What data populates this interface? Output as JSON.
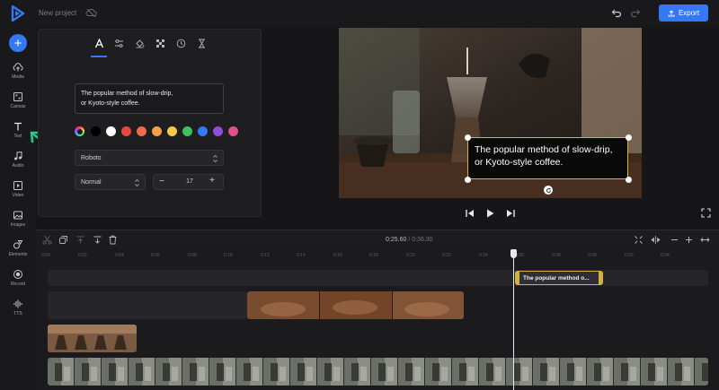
{
  "app": {
    "project_name": "New project",
    "export_label": "Export"
  },
  "sidebar": {
    "items": [
      {
        "label": "Media",
        "icon": "cloud-upload-icon"
      },
      {
        "label": "Canvas",
        "icon": "canvas-icon"
      },
      {
        "label": "Text",
        "icon": "text-icon"
      },
      {
        "label": "Audio",
        "icon": "music-note-icon"
      },
      {
        "label": "Video",
        "icon": "video-play-icon"
      },
      {
        "label": "Images",
        "icon": "image-icon"
      },
      {
        "label": "Elements",
        "icon": "shapes-icon"
      },
      {
        "label": "Record",
        "icon": "record-icon"
      },
      {
        "label": "TTS",
        "icon": "waveform-icon"
      }
    ]
  },
  "text_panel": {
    "tabs": [
      "text-style-icon",
      "sliders-icon",
      "fill-bucket-icon",
      "checkerboard-icon",
      "clock-icon",
      "hourglass-icon"
    ],
    "active_tab": "text-style-icon",
    "text_value": "The popular method of slow-drip,\nor Kyoto-style coffee.",
    "colors": [
      "#000000",
      "#ffffff",
      "#e8473f",
      "#f06a4f",
      "#f3a046",
      "#f5c84b",
      "#3fbf62",
      "#3478f6",
      "#8e4fd6",
      "#e0508c"
    ],
    "font": "Roboto",
    "weight": "Normal",
    "font_size": "17"
  },
  "preview": {
    "caption": "The popular method of slow-drip,\nor Kyoto-style coffee."
  },
  "timeline": {
    "current_time": "0:25.60",
    "separator": "/",
    "total_time": "0:36.30",
    "ruler_ticks": [
      "0:00",
      "0:02",
      "0:04",
      "0:06",
      "0:08",
      "0:10",
      "0:12",
      "0:14",
      "0:16",
      "0:18",
      "0:20",
      "0:22",
      "0:24",
      "0:26",
      "0:28",
      "0:30",
      "0:32",
      "0:34"
    ],
    "text_clip_label": "The popular method o..."
  },
  "colors": {
    "accent": "#3478f6",
    "selection": "#d6b23c",
    "annotation_arrow": "#21c98a"
  }
}
